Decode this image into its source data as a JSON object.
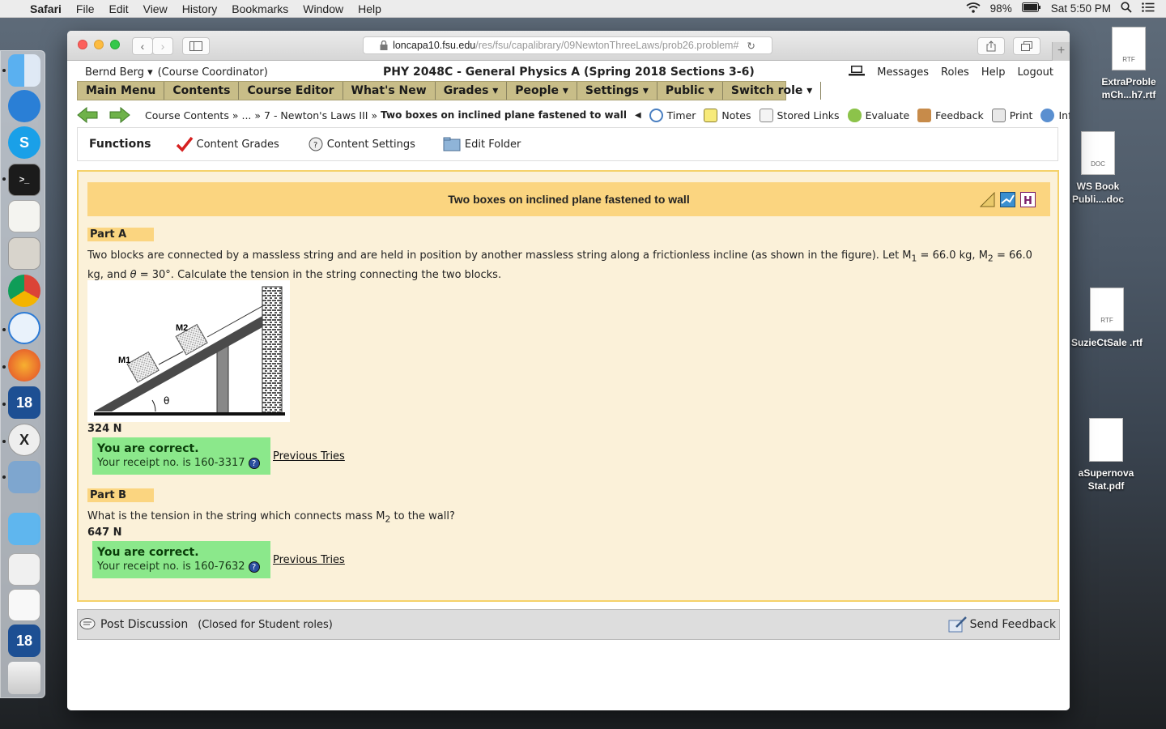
{
  "menubar": {
    "app": "Safari",
    "items": [
      "File",
      "Edit",
      "View",
      "History",
      "Bookmarks",
      "Window",
      "Help"
    ],
    "battery": "98%",
    "clock": "Sat 5:50 PM"
  },
  "browser": {
    "url_host": "loncapa10.fsu.edu",
    "url_path": "/res/fsu/capalibrary/09NewtonThreeLaws/prob26.problem#"
  },
  "desktop": [
    {
      "label": "ExtraProble mCh...h7.rtf",
      "type": "RTF"
    },
    {
      "label": "WS Book Publi....doc",
      "type": "DOC"
    },
    {
      "label": "SuzieCtSale .rtf",
      "type": "RTF"
    },
    {
      "label": "aSupernova Stat.pdf",
      "type": ""
    }
  ],
  "header": {
    "user": "Bernd Berg ▾",
    "role": "(Course Coordinator)",
    "course": "PHY 2048C - General Physics A (Spring 2018 Sections 3-6)",
    "links": [
      "Messages",
      "Roles",
      "Help",
      "Logout"
    ]
  },
  "mainnav": [
    "Main Menu",
    "Contents",
    "Course Editor",
    "What's New",
    "Grades ▾",
    "People ▾",
    "Settings ▾",
    "Public ▾",
    "Switch role ▾"
  ],
  "breadcrumbs": {
    "course_contents": "Course Contents »",
    "ellipsis": "... »",
    "folder": "7 - Newton's Laws III »",
    "current": "Two boxes on inclined plane fastened to wall"
  },
  "tools": [
    "Timer",
    "Notes",
    "Stored Links",
    "Evaluate",
    "Feedback",
    "Print",
    "Info"
  ],
  "functions": {
    "label": "Functions",
    "items": [
      "Content Grades",
      "Content Settings",
      "Edit Folder"
    ]
  },
  "problem": {
    "title": "Two boxes on inclined plane fastened to wall",
    "figure": {
      "m1": "M1",
      "m2": "M2",
      "angle": "θ"
    },
    "partA": {
      "label": "Part A",
      "text_html": "Two blocks are connected by a massless string and are held in position by another massless string along a frictionless incline (as shown in the figure). Let M<sub>1</sub> = 66.0 kg, M<sub>2</sub> = 66.0 kg, and <i>θ</i> = 30°. Calculate the tension in the string connecting the two blocks.",
      "answer": "324 N",
      "status": "You are correct.",
      "receipt": "Your receipt no. is 160-3317",
      "prev": "Previous Tries"
    },
    "partB": {
      "label": "Part B",
      "text_html": "What is the tension in the string which connects mass M<sub>2</sub> to the wall?",
      "answer": "647 N",
      "status": "You are correct.",
      "receipt": "Your receipt no. is 160-7632",
      "prev": "Previous Tries"
    },
    "qmark": "?"
  },
  "footer": {
    "discussion": "Post Discussion",
    "closed": "(Closed for Student roles)",
    "send_feedback": "Send Feedback"
  }
}
